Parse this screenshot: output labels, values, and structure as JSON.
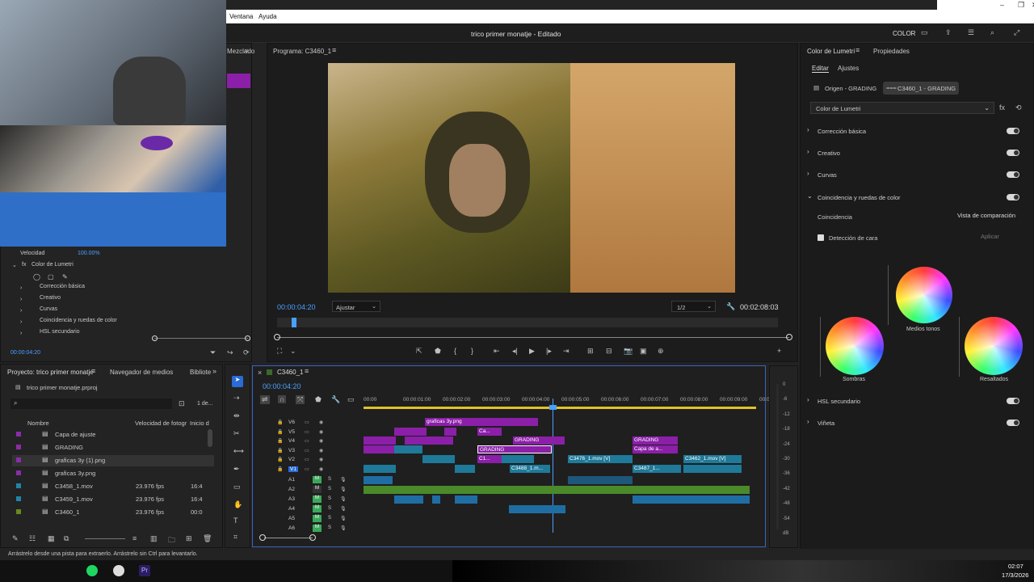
{
  "app": {
    "menu": [
      "Ventana",
      "Ayuda"
    ],
    "title": "trico primer monatje",
    "status": "Editado",
    "workspace": "COLOR"
  },
  "left_panel": {
    "tab_partial": "Mezclado",
    "velocity_label": "Velocidad",
    "velocity_value": "100.00%",
    "lumetri_label": "Color de Lumetri",
    "items": [
      "Corrección básica",
      "Creativo",
      "Curvas",
      "Coincidencia y ruedas de color",
      "HSL secundario"
    ],
    "timecode": "00:00:04:20"
  },
  "program_monitor": {
    "tab": "Programa: C3460_1",
    "timecode": "00:00:04:20",
    "fit": "Ajustar",
    "resolution": "1/2",
    "duration": "00:02:08:03"
  },
  "lumetri": {
    "tab": "Color de Lumetri",
    "tab2": "Propiedades",
    "edit_tab": "Editar",
    "adjust_tab": "Ajustes",
    "source_clip": "Origen - GRADING",
    "seq_clip": "C3460_1 - GRADING",
    "effect_select": "Color de Lumetri",
    "sections": [
      "Corrección básica",
      "Creativo",
      "Curvas",
      "Coincidencia y ruedas de color"
    ],
    "match_label": "Coincidencia",
    "compare_btn": "Vista de comparación",
    "face_detect": "Detección de cara",
    "apply_btn": "Aplicar",
    "wheels": {
      "mid": "Medios tonos",
      "shadows": "Sombras",
      "highlights": "Resaltados"
    },
    "bottom_sections": [
      "HSL secundario",
      "Viñeta"
    ]
  },
  "project": {
    "tab": "Proyecto: trico primer monatje",
    "tab2": "Navegador de medios",
    "tab3": "Bibliote",
    "file": "trico primer monatje.prproj",
    "count": "1 de...",
    "headers": {
      "name": "Nombre",
      "fps": "Velocidad de fotogr",
      "start": "Inicio d"
    },
    "rows": [
      {
        "name": "Capa de ajuste",
        "fps": "",
        "start": "",
        "color": "#8b2ca8"
      },
      {
        "name": "GRADING",
        "fps": "",
        "start": "",
        "color": "#8b2ca8"
      },
      {
        "name": "graficas 3y (1).png",
        "fps": "",
        "start": "",
        "color": "#8b2ca8"
      },
      {
        "name": "graficas 3y.png",
        "fps": "",
        "start": "",
        "color": "#8b2ca8"
      },
      {
        "name": "C3458_1.mov",
        "fps": "23.976 fps",
        "start": "16:4",
        "color": "#1f86a8"
      },
      {
        "name": "C3459_1.mov",
        "fps": "23.976 fps",
        "start": "16:4",
        "color": "#1f86a8"
      },
      {
        "name": "C3460_1",
        "fps": "23.976 fps",
        "start": "00:0",
        "color": "#6a8a1a"
      }
    ]
  },
  "timeline": {
    "tab": "C3460_1",
    "timecode": "00:00:04:20",
    "ruler": [
      "00:00",
      "00:00:01:00",
      "00:00:02:00",
      "00:00:03:00",
      "00:00:04:00",
      "00:00:05:00",
      "00:00:06:00",
      "00:00:07:00",
      "00:00:08:00",
      "00:00:09:00",
      "00:0"
    ],
    "video_tracks": [
      "V6",
      "V5",
      "V4",
      "V3",
      "V2",
      "V1"
    ],
    "audio_tracks": [
      "A1",
      "A2",
      "A3",
      "A4",
      "A5",
      "A6"
    ],
    "clips": {
      "graficas": "graficas 3y.png",
      "ca": "Ca...",
      "grading1": "GRADING",
      "grading2": "GRADING",
      "grading3": "GRADING",
      "capa": "Capa de a...",
      "c1": "C1...",
      "c3476": "C3476_1.mov [V]",
      "c3462": "C3462_1.mov [V]",
      "c3488": "C3488_1.m...",
      "c3487": "C3487_1...",
      "fx": "fx"
    },
    "db_scale": [
      "0",
      "-6",
      "-12",
      "-18",
      "-24",
      "-30",
      "-36",
      "-42",
      "-48",
      "-54",
      "dB"
    ]
  },
  "status_bar": "Arrástrelo desde una pista para extraerlo. Arrástrelo sin Ctrl para levantarlo.",
  "taskbar": {
    "time": "02:07",
    "date": "17/3/2026"
  }
}
